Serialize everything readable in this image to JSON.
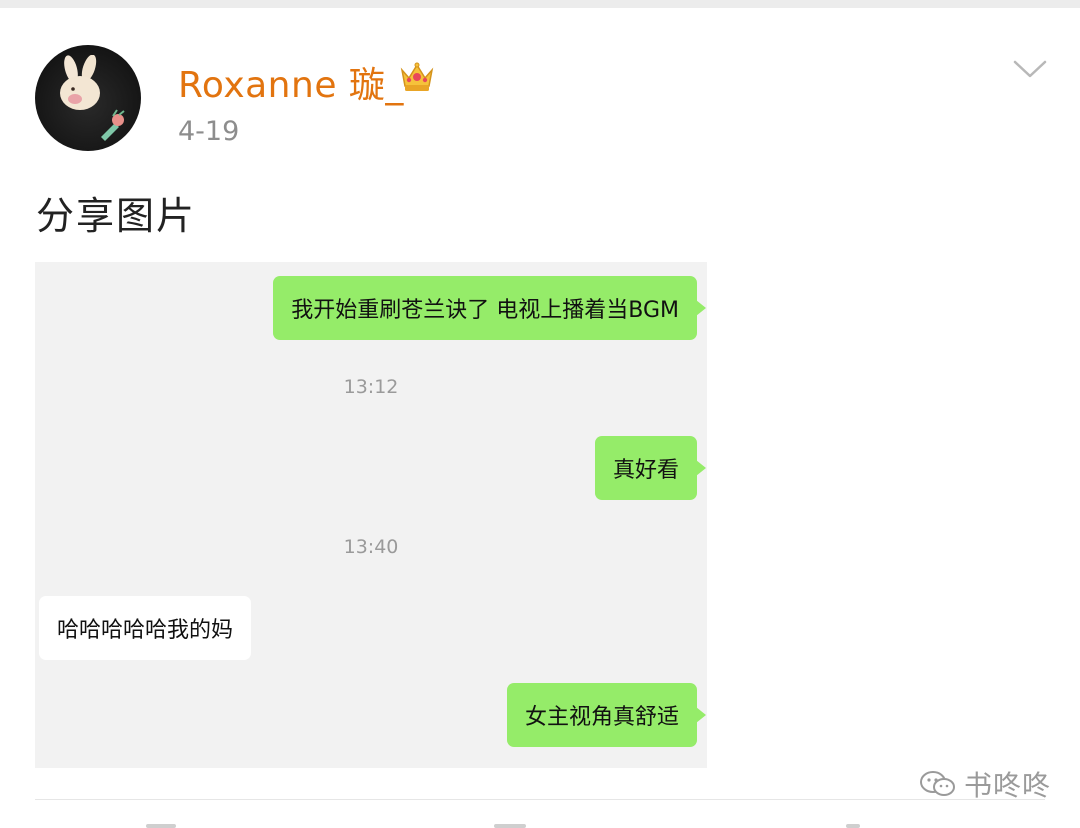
{
  "post": {
    "username": "Roxanne 璇_",
    "date": "4-19",
    "text": "分享图片"
  },
  "chat": {
    "messages": [
      {
        "side": "right",
        "text": "我开始重刷苍兰诀了 电视上播着当BGM"
      },
      {
        "type": "time",
        "text": "13:12"
      },
      {
        "side": "right",
        "text": "真好看"
      },
      {
        "type": "time",
        "text": "13:40"
      },
      {
        "side": "left",
        "text": "哈哈哈哈哈我的妈"
      },
      {
        "side": "right",
        "text": "女主视角真舒适"
      }
    ]
  },
  "watermark": {
    "text": "书咚咚"
  },
  "colors": {
    "username": "#e2740f",
    "bubble_self": "#95ec69",
    "bubble_other": "#ffffff",
    "chat_bg": "#f2f2f2"
  },
  "icons": {
    "crown": "crown-badge-icon",
    "menu": "chevron-down-icon",
    "watermark": "wechat-icon"
  }
}
